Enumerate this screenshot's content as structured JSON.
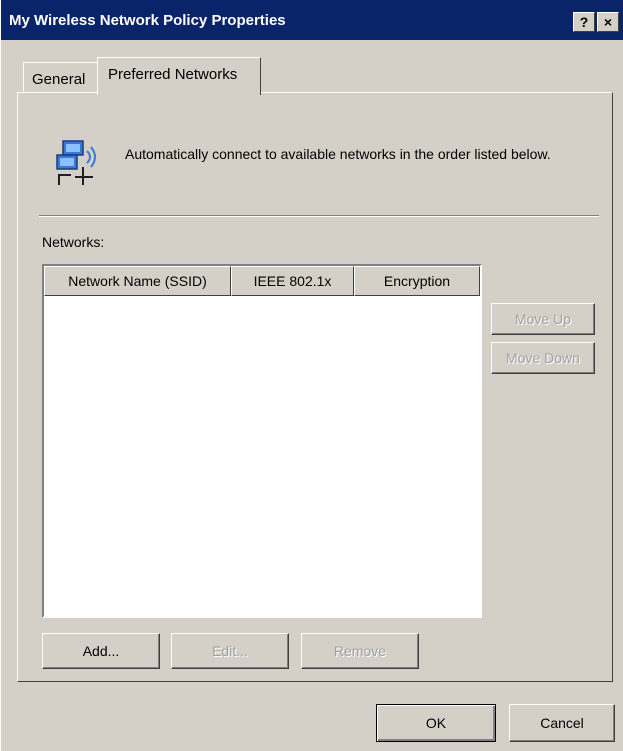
{
  "window": {
    "title": "My Wireless Network Policy Properties",
    "help_label": "?",
    "close_label": "×"
  },
  "tabs": [
    {
      "label": "General",
      "selected": false
    },
    {
      "label": "Preferred Networks",
      "selected": true
    }
  ],
  "info": {
    "text": "Automatically connect to available networks in the order listed below."
  },
  "networks": {
    "label": "Networks:",
    "columns": [
      "Network Name (SSID)",
      "IEEE 802.1x",
      "Encryption"
    ],
    "rows": []
  },
  "side_buttons": {
    "move_up": "Move Up",
    "move_down": "Move Down"
  },
  "list_buttons": {
    "add": "Add...",
    "edit": "Edit...",
    "remove": "Remove"
  },
  "dialog_buttons": {
    "ok": "OK",
    "cancel": "Cancel"
  },
  "colors": {
    "title_bar": "#0a246a",
    "face": "#d4d0c8"
  },
  "icons": [
    "help-icon",
    "close-icon",
    "wireless-network-icon"
  ]
}
